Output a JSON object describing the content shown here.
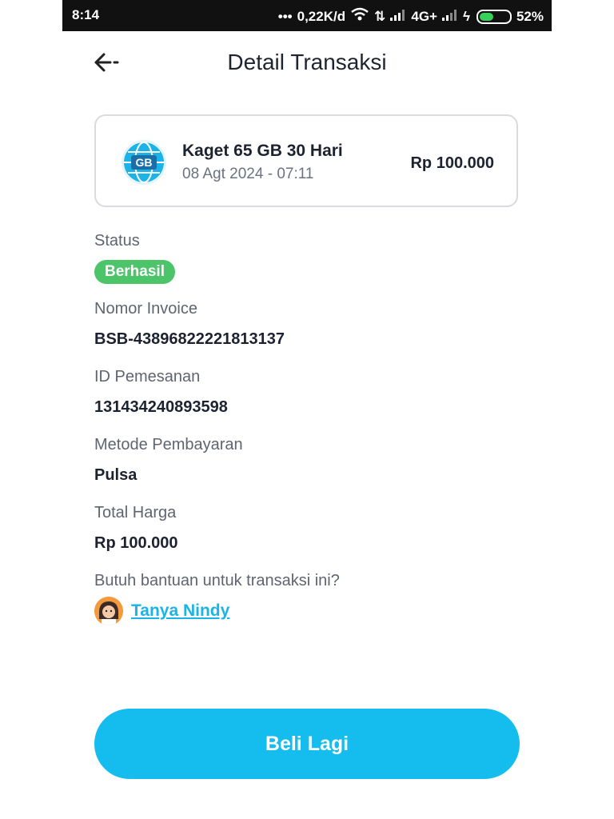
{
  "status_bar": {
    "time": "8:14",
    "network_speed": "0,22K/d",
    "network_type": "4G+",
    "battery": "52%",
    "battery_level": 0.52,
    "icons": [
      "more-dots-icon",
      "wifi-icon",
      "data-arrows-icon",
      "signal-icon",
      "signal-icon",
      "charging-icon",
      "battery-icon"
    ]
  },
  "header": {
    "back_icon": "arrow-left-icon",
    "title": "Detail Transaksi"
  },
  "product": {
    "icon": "globe-gb-icon",
    "icon_text": "GB",
    "name": "Kaget 65 GB 30 Hari",
    "date": "08 Agt 2024 - 07:11",
    "price": "Rp 100.000"
  },
  "details": {
    "status_label": "Status",
    "status_value": "Berhasil",
    "invoice_label": "Nomor Invoice",
    "invoice_value": "BSB-43896822221813137",
    "order_label": "ID Pemesanan",
    "order_value": "131434240893598",
    "payment_label": "Metode Pembayaran",
    "payment_value": "Pulsa",
    "total_label": "Total Harga",
    "total_value": "Rp 100.000"
  },
  "help": {
    "question": "Butuh bantuan untuk transaksi ini?",
    "link": "Tanya Nindy",
    "avatar_icon": "assistant-avatar-icon"
  },
  "cta": {
    "label": "Beli Lagi"
  },
  "colors": {
    "accent": "#15bdee",
    "success": "#4cc46a",
    "statusbar": "#111111"
  }
}
